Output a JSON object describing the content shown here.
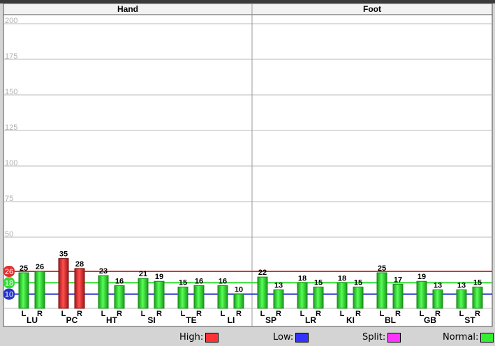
{
  "chart_data": {
    "type": "bar",
    "panels": [
      "Hand",
      "Foot"
    ],
    "ylim": [
      0,
      200
    ],
    "yticks": [
      50,
      75,
      100,
      125,
      150,
      175,
      200
    ],
    "grid": true,
    "groups": [
      {
        "name": "LU",
        "panel": "Hand",
        "L": 25,
        "R": 26
      },
      {
        "name": "PC",
        "panel": "Hand",
        "L": 35,
        "R": 28
      },
      {
        "name": "HT",
        "panel": "Hand",
        "L": 23,
        "R": 16
      },
      {
        "name": "SI",
        "panel": "Hand",
        "L": 21,
        "R": 19
      },
      {
        "name": "TE",
        "panel": "Hand",
        "L": 15,
        "R": 16
      },
      {
        "name": "LI",
        "panel": "Hand",
        "L": 16,
        "R": 10
      },
      {
        "name": "SP",
        "panel": "Foot",
        "L": 22,
        "R": 13
      },
      {
        "name": "LR",
        "panel": "Foot",
        "L": 18,
        "R": 15
      },
      {
        "name": "KI",
        "panel": "Foot",
        "L": 18,
        "R": 15
      },
      {
        "name": "BL",
        "panel": "Foot",
        "L": 25,
        "R": 17
      },
      {
        "name": "GB",
        "panel": "Foot",
        "L": 19,
        "R": 13
      },
      {
        "name": "ST",
        "panel": "Foot",
        "L": 13,
        "R": 15
      }
    ],
    "side_labels": [
      "L",
      "R"
    ],
    "thresholds": {
      "high": {
        "value": 26,
        "label": "26",
        "color": "#e03030"
      },
      "normal": {
        "value": 18,
        "label": "18",
        "color": "#33dd33"
      },
      "low": {
        "value": 10,
        "label": "10",
        "color": "#2233cc"
      }
    },
    "colors": {
      "high_bar": "#ee2222",
      "normal_bar": "#33ee33",
      "low": "#3333ff",
      "split": "#ff33ff"
    }
  },
  "legend": [
    {
      "label": "High:",
      "color": "#ff3333"
    },
    {
      "label": "Low:",
      "color": "#3333ff"
    },
    {
      "label": "Split:",
      "color": "#ff33ff"
    },
    {
      "label": "Normal:",
      "color": "#33ee33"
    }
  ]
}
